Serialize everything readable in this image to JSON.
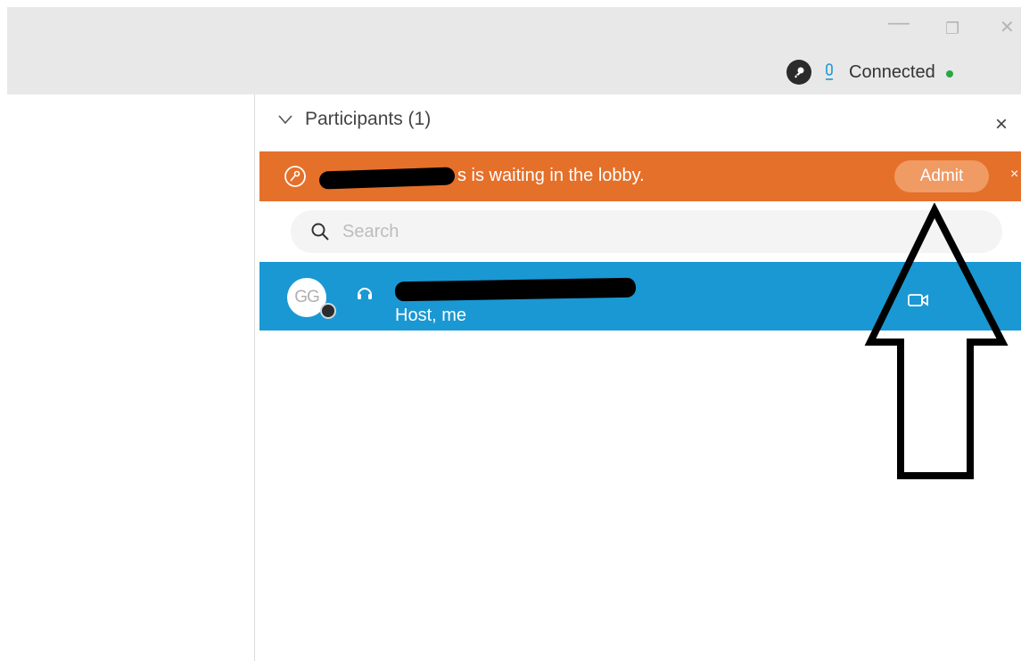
{
  "window": {
    "minimize_glyph": "—",
    "maximize_glyph": "❐",
    "close_glyph": "✕",
    "status": {
      "key_icon": "key-icon",
      "mic_icon": "microphone-icon",
      "connection_text": "Connected",
      "connection_color": "#27a844"
    }
  },
  "panel": {
    "title": "Participants (1)",
    "collapse_icon": "chevron-down-icon",
    "close_glyph": "×",
    "lobby": {
      "icon": "lock-key-icon",
      "message": "s is waiting in the lobby.",
      "admit_label": "Admit",
      "dismiss_glyph": "×",
      "background": "#e5702a"
    },
    "search": {
      "icon": "search-icon",
      "placeholder": "Search"
    },
    "participants": [
      {
        "initials": "GG",
        "role": "Host, me",
        "audio_icon": "headset-icon",
        "video_icon": "video-camera-icon",
        "background": "#1a98d3"
      }
    ]
  },
  "annotation": {
    "icon": "up-arrow-annotation"
  }
}
